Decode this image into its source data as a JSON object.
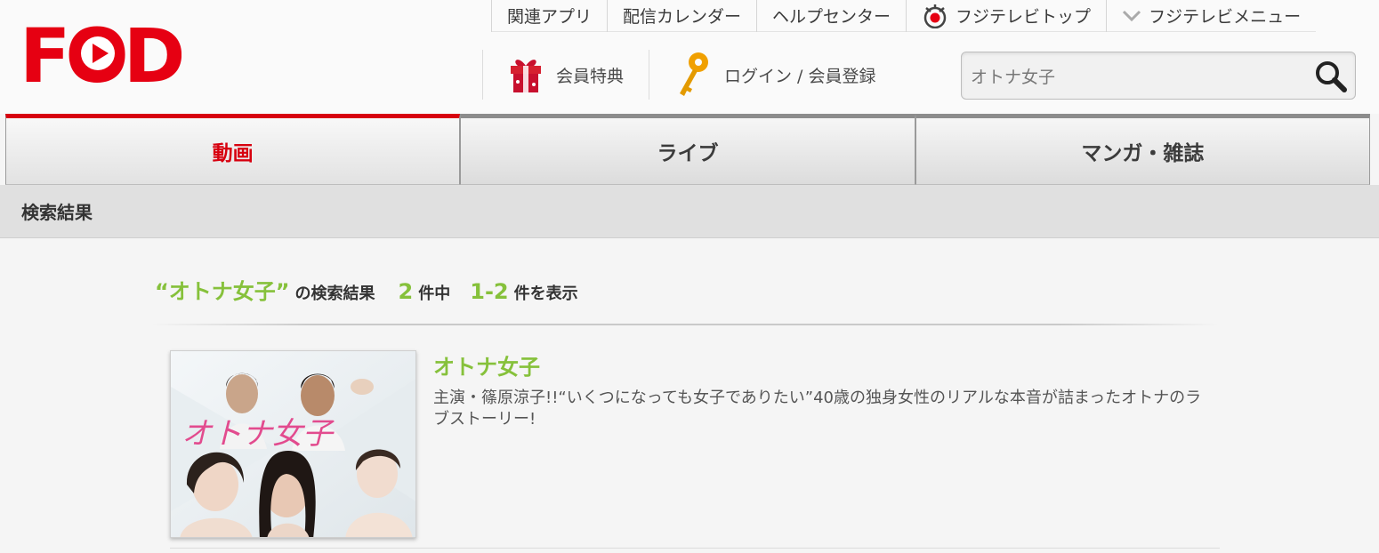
{
  "header": {
    "logo_text": "FOD",
    "util_links": [
      {
        "label": "関連アプリ"
      },
      {
        "label": "配信カレンダー"
      },
      {
        "label": "ヘルプセンター"
      },
      {
        "label": "フジテレビトップ",
        "icon": "fujitv-eye-icon"
      },
      {
        "label": "フジテレビメニュー",
        "icon": "chevron-down-icon"
      }
    ],
    "member_links": [
      {
        "label": "会員特典",
        "icon": "gift-icon"
      },
      {
        "label": "ログイン / 会員登録",
        "icon": "key-icon"
      }
    ],
    "search": {
      "value": "オトナ女子",
      "icon": "search-icon"
    }
  },
  "tabs": [
    {
      "label": "動画",
      "active": true
    },
    {
      "label": "ライブ",
      "active": false
    },
    {
      "label": "マンガ・雑誌",
      "active": false
    }
  ],
  "section_title": "検索結果",
  "summary": {
    "query": "“オトナ女子”",
    "label_results": "の検索結果",
    "total": "2",
    "label_of": "件中",
    "range": "1-2",
    "label_showing": "件を表示"
  },
  "results": [
    {
      "title": "オトナ女子",
      "description": "主演・篠原涼子!!“いくつになっても女子でありたい”40歳の独身女性のリアルな本音が詰まったオトナのラブストーリー!",
      "thumbnail_text": "オトナ女子"
    }
  ],
  "colors": {
    "brand_red": "#e60012",
    "accent_green": "#86c13b",
    "active_tab": "#d7000f"
  }
}
